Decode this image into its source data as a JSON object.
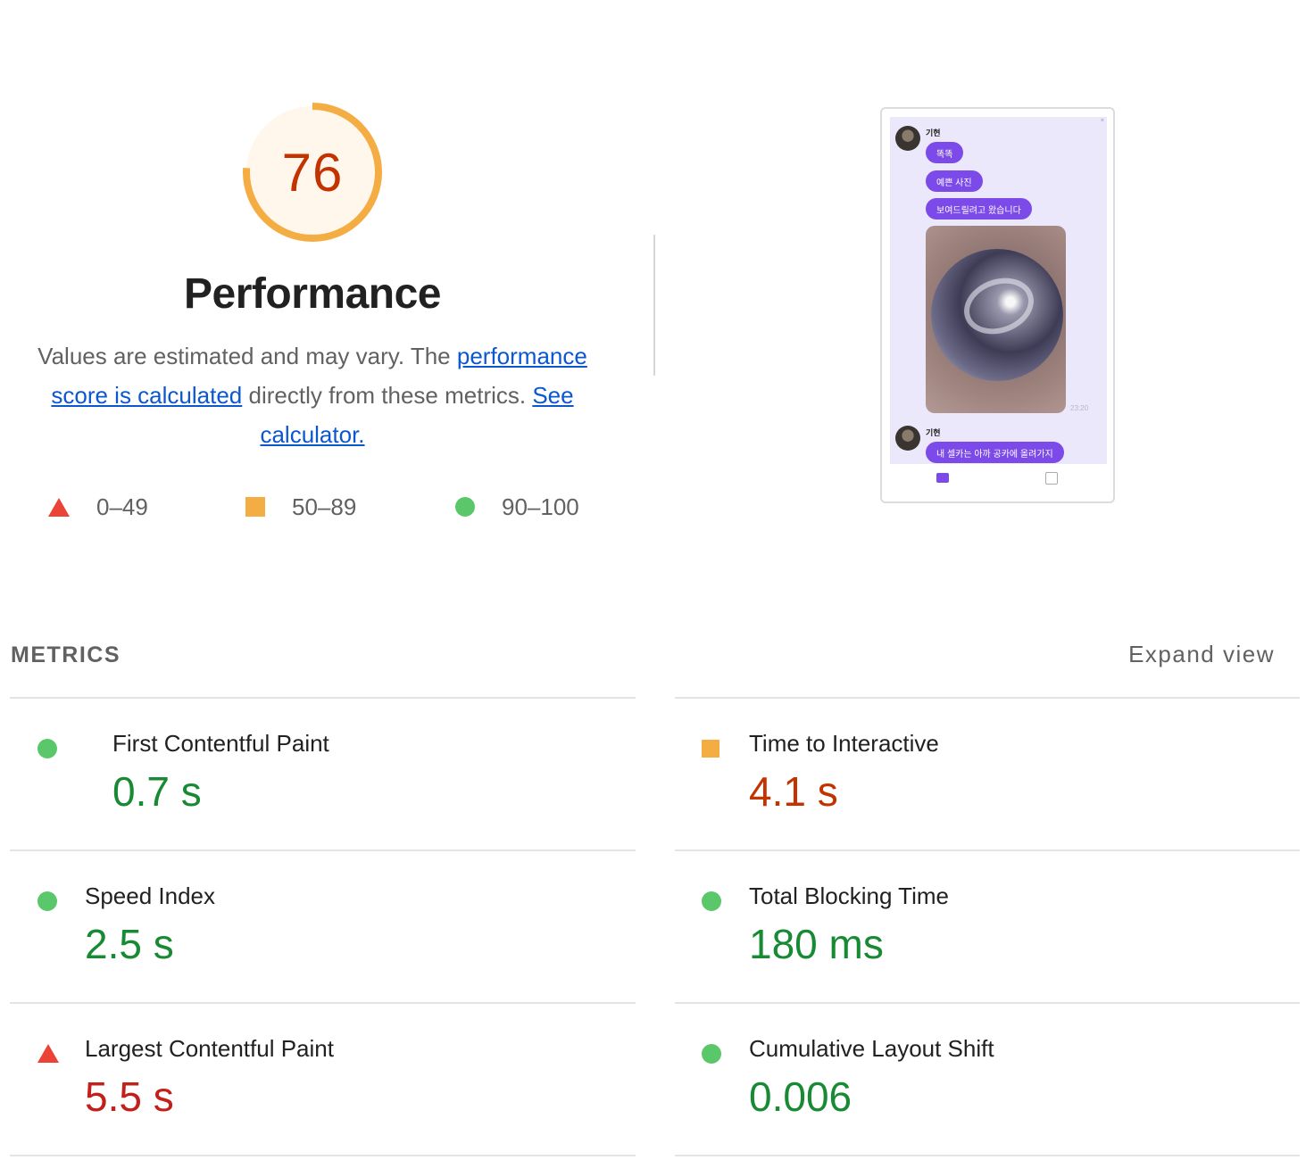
{
  "summary": {
    "score": "76",
    "score_fraction": 0.76,
    "gauge_color": "#f4ad42",
    "gauge_bg": "#fff6ec",
    "score_color": "#c33300",
    "title": "Performance",
    "desc_prefix": "Values are estimated and may vary. The ",
    "desc_link1": "performance score is calculated",
    "desc_middle": " directly from these metrics. ",
    "desc_link2": "See calculator."
  },
  "legend": [
    {
      "range": "0–49",
      "shape": "triangle",
      "color": "#eb4335"
    },
    {
      "range": "50–89",
      "shape": "square",
      "color": "#f4ad42"
    },
    {
      "range": "90–100",
      "shape": "circle",
      "color": "#5ac86a"
    }
  ],
  "thumbnail": {
    "sender_1": "기현",
    "bubbles": [
      "똑똑",
      "예쁜 사진",
      "보여드릴려고 왔습니다"
    ],
    "time": "23:20",
    "sender_2": "기현",
    "bubble_last": "내 셀카는 아까 공카에 올려가지",
    "accent": "#7b4ae8"
  },
  "metrics_section": {
    "title": "METRICS",
    "expand_label": "Expand view"
  },
  "metrics": [
    {
      "name": "First Contentful Paint",
      "value": "0.7 s",
      "rating": "pass"
    },
    {
      "name": "Time to Interactive",
      "value": "4.1 s",
      "rating": "average"
    },
    {
      "name": "Speed Index",
      "value": "2.5 s",
      "rating": "pass"
    },
    {
      "name": "Total Blocking Time",
      "value": "180 ms",
      "rating": "pass"
    },
    {
      "name": "Largest Contentful Paint",
      "value": "5.5 s",
      "rating": "fail"
    },
    {
      "name": "Cumulative Layout Shift",
      "value": "0.006",
      "rating": "pass"
    }
  ]
}
